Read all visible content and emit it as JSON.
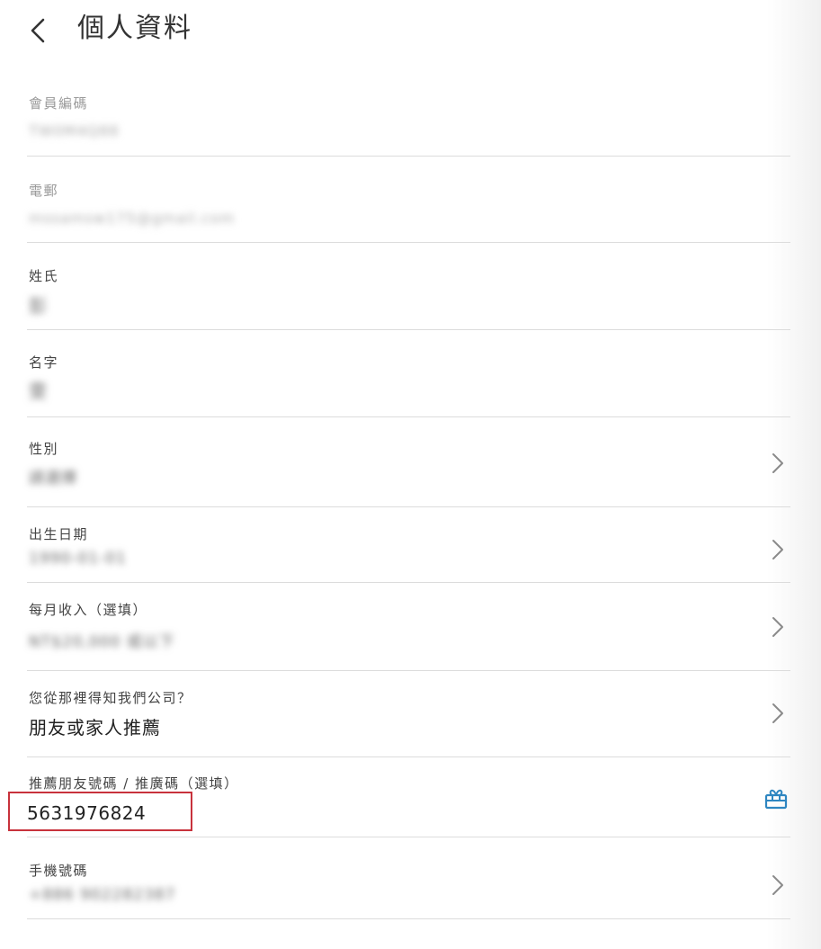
{
  "header": {
    "title": "個人資料",
    "back_icon": "chevron-left-icon"
  },
  "fields": {
    "member_id": {
      "label": "會員編碼",
      "value": "TW0M4Q88"
    },
    "email": {
      "label": "電郵",
      "value": "mssamsw175@gmail.com"
    },
    "last_name": {
      "label": "姓氏",
      "value": "彭"
    },
    "first_name": {
      "label": "名字",
      "value": "雯"
    },
    "gender": {
      "label": "性別",
      "value": "請選擇"
    },
    "birthday": {
      "label": "出生日期",
      "value": "1990-01-01"
    },
    "income": {
      "label": "每月收入（選填）",
      "value": "NT$20,000 或以下"
    },
    "source": {
      "label": "您從那裡得知我們公司？",
      "value": "朋友或家人推薦"
    },
    "referral": {
      "label": "推薦朋友號碼 / 推廣碼（選填）",
      "value": "5631976824",
      "icon": "gift-icon"
    },
    "phone": {
      "label": "手機號碼",
      "value": "+886 902282387"
    }
  },
  "colors": {
    "highlight": "#c8323c",
    "gift_icon": "#2e86c1",
    "divider": "#dcdcdc"
  }
}
